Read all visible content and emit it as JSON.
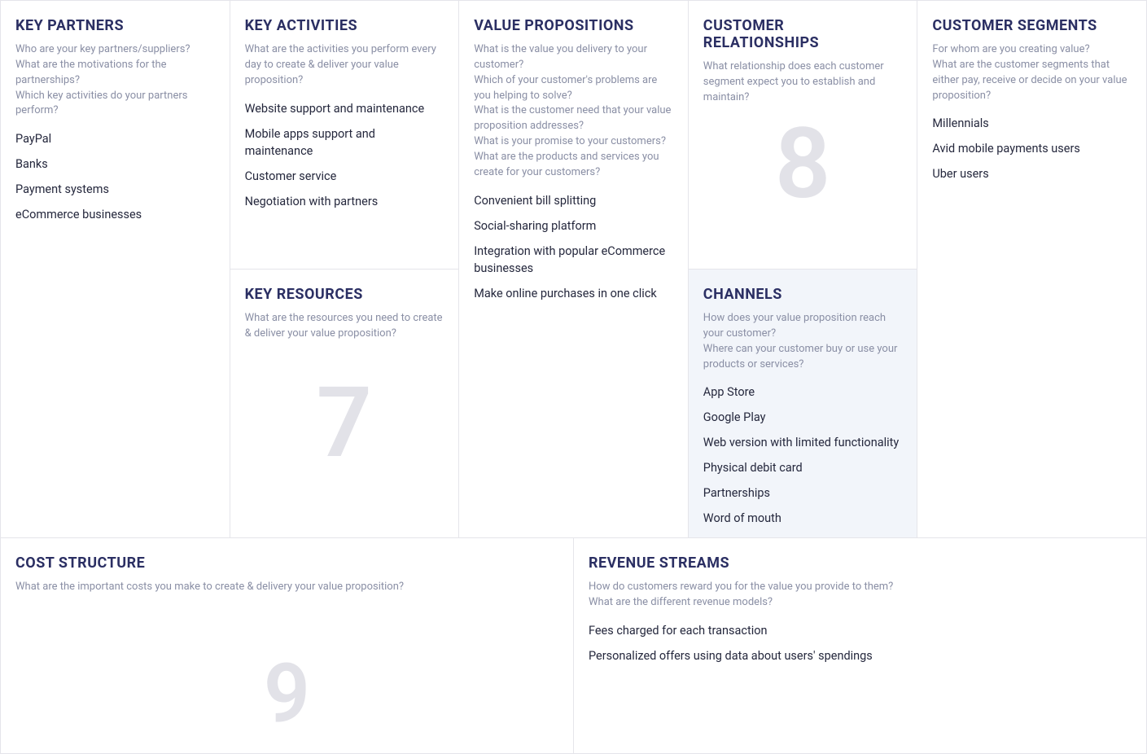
{
  "blocks": {
    "key_partners": {
      "title": "KEY PARTNERS",
      "desc": "Who are your key partners/suppliers?\nWhat are the motivations for the partnerships?\nWhich key activities do your partners perform?",
      "items": [
        "PayPal",
        "Banks",
        "Payment systems",
        "eCommerce businesses"
      ]
    },
    "key_activities": {
      "title": "KEY ACTIVITIES",
      "desc": "What are the activities you perform every day to create & deliver your value proposition?",
      "items": [
        "Website support and maintenance",
        "Mobile apps support and maintenance",
        "Customer service",
        "Negotiation with partners"
      ]
    },
    "key_resources": {
      "title": "KEY RESOURCES",
      "desc": "What are the resources you need to create & deliver your value proposition?",
      "items": [],
      "placeholder": "7"
    },
    "value_propositions": {
      "title": "VALUE PROPOSITIONS",
      "desc": "What is the value you delivery to your customer?\nWhich of your customer's problems are you helping to solve?\nWhat is the customer need that your value proposition addresses?\nWhat is your promise to your customers?\nWhat are the products and services you create for your customers?",
      "items": [
        "Convenient bill splitting",
        "Social-sharing platform",
        "Integration with popular eCommerce businesses",
        "Make online purchases in one click"
      ]
    },
    "customer_relationships": {
      "title": "CUSTOMER RELATIONSHIPS",
      "desc": "What relationship does each customer segment expect you to establish and maintain?",
      "items": [],
      "placeholder": "8"
    },
    "channels": {
      "title": "CHANNELS",
      "desc": "How does your value proposition reach your customer?\nWhere can your customer buy or use your products or services?",
      "items": [
        "App Store",
        "Google Play",
        "Web version with limited functionality",
        "Physical debit card",
        "Partnerships",
        "Word of mouth"
      ]
    },
    "customer_segments": {
      "title": "CUSTOMER SEGMENTS",
      "desc": "For whom are you creating value?\nWhat are the customer segments that either pay, receive or decide on your value proposition?",
      "items": [
        "Millennials",
        "Avid mobile payments users",
        "Uber users"
      ]
    },
    "cost_structure": {
      "title": "COST STRUCTURE",
      "desc": "What are the important costs you make to create & delivery your value proposition?",
      "items": [],
      "placeholder": "9"
    },
    "revenue_streams": {
      "title": "REVENUE STREAMS",
      "desc": "How do customers reward you for the value you provide to them?\nWhat are the different revenue models?",
      "items": [
        "Fees charged for each transaction",
        "Personalized offers using data about users' spendings"
      ]
    }
  }
}
